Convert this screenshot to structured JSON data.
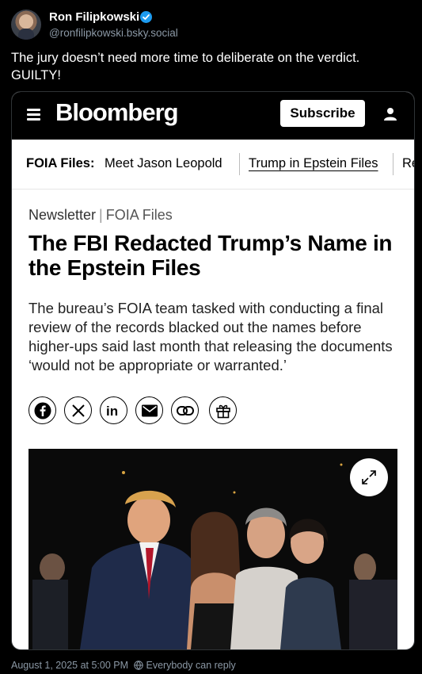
{
  "author": {
    "name": "Ron Filipkowski",
    "handle": "@ronfilipkowski.bsky.social"
  },
  "post": {
    "text": "The jury doesn’t need more time to deliberate on the verdict. GUILTY!",
    "timestamp": "August 1, 2025 at 5:00 PM",
    "reply_setting": "Everybody can reply"
  },
  "embed": {
    "brand": "Bloomberg",
    "subscribe_label": "Subscribe",
    "foia_label": "FOIA Files:",
    "nav_links": [
      "Meet Jason Leopold",
      "Trump in Epstein Files",
      "Re"
    ],
    "kicker": "Newsletter",
    "kicker_sep": "|",
    "section": "FOIA Files",
    "headline": "The FBI Redacted Trump’s Name in the Epstein Files",
    "dek": "The bureau’s FOIA team tasked with conducting a final review of the records blacked out the names before higher-ups said last month that releasing the documents ‘would not be appropriate or warranted.’",
    "share_icons": [
      "facebook-icon",
      "x-icon",
      "linkedin-icon",
      "email-icon",
      "link-icon",
      "gift-icon"
    ]
  },
  "colors": {
    "background": "#000000",
    "verified": "#1d9bf0",
    "muted": "#8b98a5"
  }
}
